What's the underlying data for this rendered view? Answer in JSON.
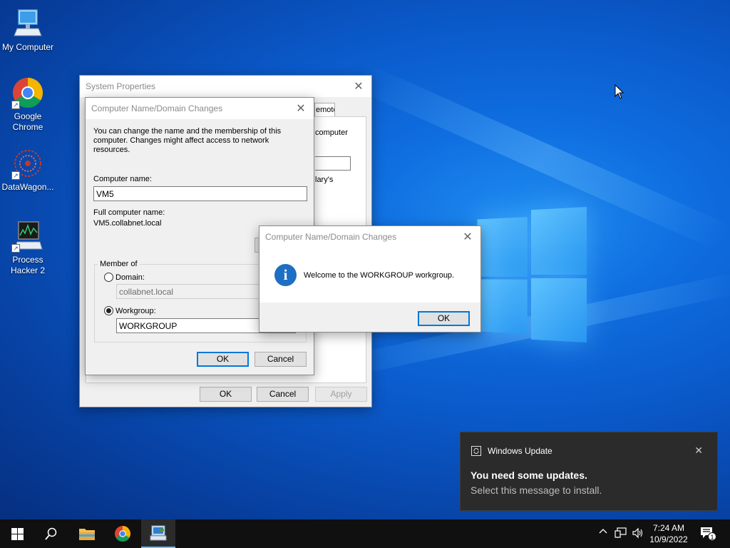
{
  "desktop": {
    "icons": [
      {
        "label": "My Computer"
      },
      {
        "label": "Google Chrome"
      },
      {
        "label": "DataWagon..."
      },
      {
        "label": "Process Hacker 2"
      }
    ]
  },
  "system_properties": {
    "title": "System Properties",
    "tab_partial": "emote",
    "partial_text_1": "computer",
    "partial_text_2": "lary's",
    "ok": "OK",
    "cancel": "Cancel",
    "apply": "Apply"
  },
  "domain_changes": {
    "title": "Computer Name/Domain Changes",
    "description": "You can change the name and the membership of this computer. Changes might affect access to network resources.",
    "computer_name_label": "Computer name:",
    "computer_name_value": "VM5",
    "full_name_label": "Full computer name:",
    "full_name_value": "VM5.collabnet.local",
    "member_of_label": "Member of",
    "domain_label": "Domain:",
    "domain_value": "collabnet.local",
    "workgroup_label": "Workgroup:",
    "workgroup_value": "WORKGROUP",
    "ok": "OK",
    "cancel": "Cancel"
  },
  "welcome_dialog": {
    "title": "Computer Name/Domain Changes",
    "message": "Welcome to the WORKGROUP workgroup.",
    "ok": "OK"
  },
  "toast": {
    "app": "Windows Update",
    "heading": "You need some updates.",
    "body": "Select this message to install."
  },
  "taskbar": {
    "time": "7:24 AM",
    "date": "10/9/2022",
    "notification_count": "1"
  },
  "colors": {
    "accent": "#0078d7",
    "info_icon": "#1e6fc4",
    "taskbar": "#101010"
  }
}
